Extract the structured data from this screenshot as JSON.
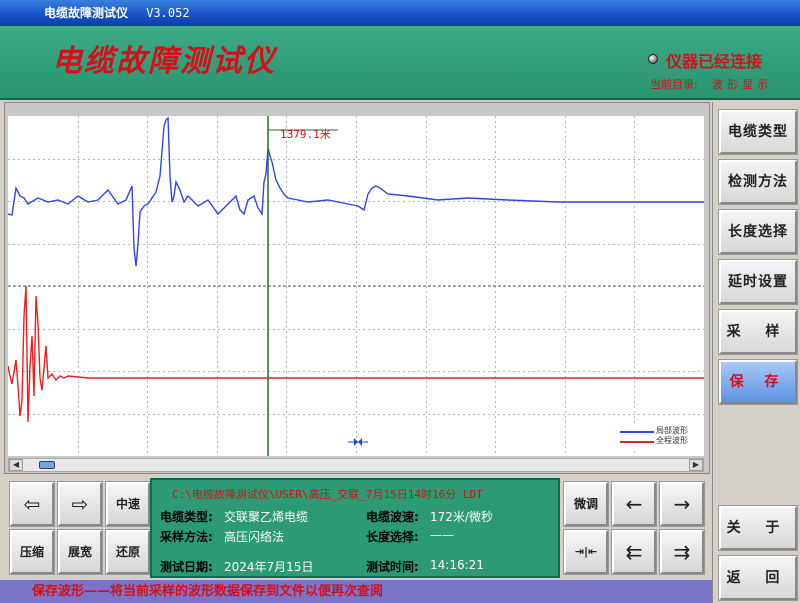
{
  "window": {
    "title": "电缆故障测试仪",
    "version": "V3.052"
  },
  "header": {
    "app_title": "电缆故障测试仪",
    "connection_status": "仪器已经连接",
    "dir_label": "当前目录:",
    "dir_value": "波形显示"
  },
  "plot": {
    "cursor_label": "1379.1米",
    "legend": [
      {
        "name": "局部波形",
        "color": "#3344ee"
      },
      {
        "name": "全程波形",
        "color": "#e82020"
      }
    ]
  },
  "chart_data": {
    "type": "line",
    "title": "",
    "series": [
      {
        "name": "局部波形",
        "color": "#3344ee",
        "x": [
          0,
          4,
          8,
          12,
          16,
          20,
          30,
          40,
          50,
          60,
          70,
          80,
          90,
          100,
          110,
          118,
          124,
          126,
          128,
          130,
          132,
          136,
          140,
          144,
          148,
          152,
          156,
          158,
          160,
          162,
          164,
          166,
          168,
          172,
          176,
          180,
          190,
          200,
          210,
          220,
          228,
          232,
          236,
          240,
          246,
          250,
          254,
          256,
          258,
          260,
          262,
          264,
          268,
          272,
          276,
          280,
          290,
          300,
          320,
          340,
          350,
          356,
          360,
          364,
          368,
          372,
          380,
          400,
          430,
          460,
          500,
          550,
          600,
          650,
          696
        ],
        "y": [
          98,
          99,
          72,
          80,
          82,
          88,
          82,
          86,
          84,
          88,
          80,
          86,
          84,
          74,
          88,
          84,
          70,
          132,
          150,
          128,
          96,
          90,
          88,
          82,
          76,
          60,
          10,
          4,
          2,
          60,
          86,
          80,
          66,
          74,
          86,
          80,
          90,
          84,
          98,
          88,
          80,
          94,
          98,
          84,
          80,
          92,
          98,
          66,
          58,
          32,
          40,
          46,
          64,
          72,
          78,
          82,
          84,
          86,
          84,
          88,
          90,
          94,
          78,
          72,
          70,
          72,
          78,
          80,
          84,
          82,
          84,
          86,
          86,
          86,
          86
        ]
      },
      {
        "name": "全程波形",
        "color": "#e82020",
        "x": [
          0,
          2,
          4,
          6,
          8,
          10,
          12,
          14,
          16,
          18,
          20,
          22,
          24,
          26,
          28,
          30,
          32,
          34,
          36,
          38,
          40,
          44,
          48,
          52,
          56,
          60,
          70,
          80,
          100,
          150,
          200,
          250,
          300,
          350,
          400,
          450,
          500,
          550,
          600,
          650,
          696
        ],
        "y": [
          250,
          260,
          268,
          256,
          244,
          270,
          300,
          284,
          200,
          170,
          306,
          250,
          220,
          280,
          180,
          208,
          262,
          274,
          252,
          230,
          262,
          258,
          264,
          260,
          262,
          260,
          261,
          262,
          262,
          262,
          262,
          262,
          262,
          262,
          262,
          262,
          262,
          262,
          262,
          262,
          262
        ]
      }
    ],
    "cursor_x": 260,
    "marker_x": 350,
    "xlim": [
      0,
      696
    ],
    "ylim": [
      0,
      340
    ],
    "grid": true
  },
  "right_panel": {
    "buttons": [
      {
        "label": "电缆类型",
        "active": false
      },
      {
        "label": "检测方法",
        "active": false
      },
      {
        "label": "长度选择",
        "active": false
      },
      {
        "label": "延时设置",
        "active": false
      },
      {
        "label": "采 样",
        "active": false
      },
      {
        "label": "保 存",
        "active": true
      }
    ],
    "close_label": "关 于",
    "back_label": "返 回"
  },
  "keypad": {
    "left_arrow": "⇦",
    "right_arrow": "⇨",
    "mid_speed": "中速",
    "compress": "压缩",
    "expand": "展宽",
    "restore": "还原",
    "fine_tune": "微调",
    "nudge_left": "←",
    "nudge_right": "→",
    "jump_to": "⇥|⇤",
    "page_left": "⇇",
    "page_right": "⇉"
  },
  "info": {
    "path": "C:\\电缆故障测试仪\\USER\\高压_交联_7月15日14时16分 LDT",
    "cable_type_label": "电缆类型:",
    "cable_type_value": "交联聚乙烯电缆",
    "wave_speed_label": "电缆波速:",
    "wave_speed_value": "172米/微秒",
    "method_label": "采样方法:",
    "method_value": "高压闪络法",
    "length_label": "长度选择:",
    "length_value": "——",
    "date_label": "测试日期:",
    "date_value": "2024年7月15日",
    "time_label": "测试时间:",
    "time_value": "14:16:21"
  },
  "status_bar": {
    "text": "保存波形——将当前采样的波形数据保存到文件以便再次查阅"
  }
}
